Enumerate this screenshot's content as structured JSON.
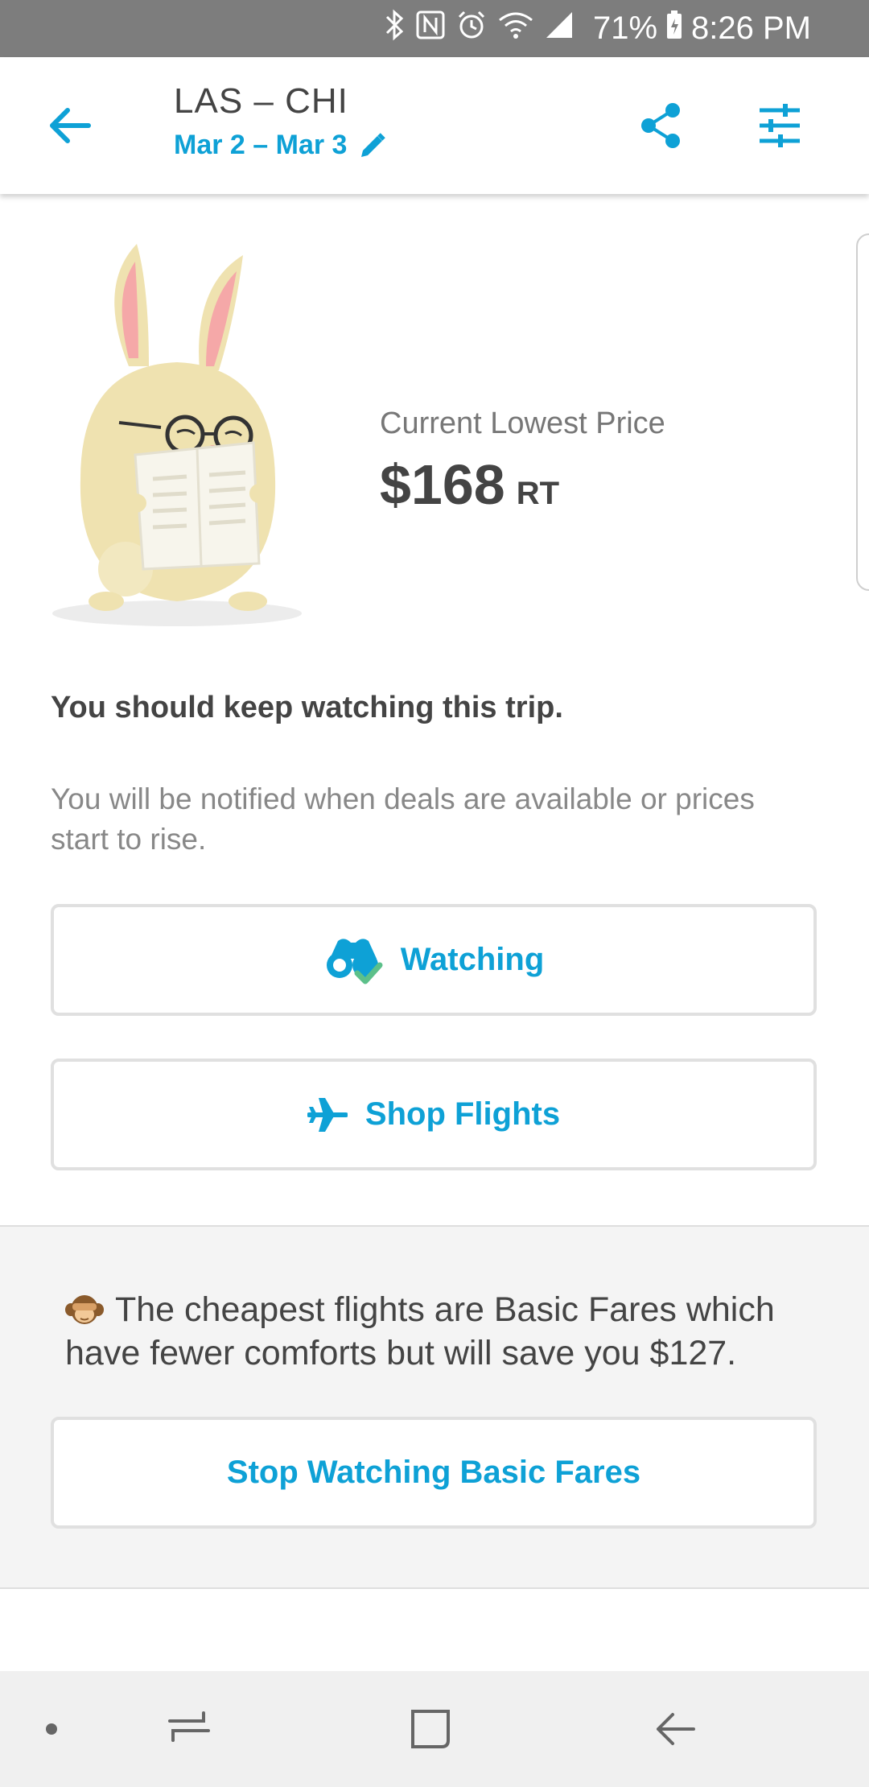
{
  "status_bar": {
    "battery": "71%",
    "time": "8:26 PM"
  },
  "header": {
    "route": "LAS – CHI",
    "dates": "Mar 2 – Mar 3"
  },
  "price": {
    "label": "Current Lowest Price",
    "value": "$168",
    "unit": "RT"
  },
  "advice": {
    "title": "You should keep watching this trip.",
    "body": "You will be notified when deals are available or prices start to rise."
  },
  "buttons": {
    "watching": "Watching",
    "shop_flights": "Shop Flights",
    "stop_basic": "Stop Watching Basic Fares"
  },
  "basic_fares": {
    "message": "The cheapest flights are Basic Fares which have fewer comforts but will save you $127."
  },
  "colors": {
    "accent": "#0ea1d6",
    "check": "#5cc08a",
    "status_bar": "#7d7d7d"
  }
}
